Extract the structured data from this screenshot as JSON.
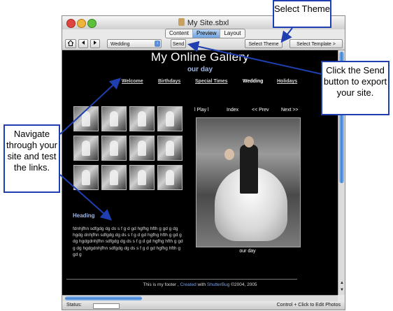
{
  "window": {
    "title": "My Site.sbxl",
    "mode_tabs": [
      {
        "label": "Content",
        "active": false
      },
      {
        "label": "Preview",
        "active": true
      },
      {
        "label": "Layout",
        "active": false
      }
    ]
  },
  "toolbar": {
    "theme_value": "Wedding",
    "send_label": "Send",
    "select_theme_label": "Select Theme",
    "select_template_label": "Select Template >"
  },
  "page": {
    "title": "My Online Gallery",
    "subtitle": "our day",
    "nav": [
      {
        "label": "Welcome",
        "current": false
      },
      {
        "label": "Birthdays",
        "current": false
      },
      {
        "label": "Special Times",
        "current": false
      },
      {
        "label": "Wedding",
        "current": true
      },
      {
        "label": "Holidays",
        "current": false
      }
    ],
    "viewer_controls": [
      "l Play l",
      "Index",
      "<< Prev",
      "Next >>"
    ],
    "thumbnail_count": 12,
    "photo_caption": "our day",
    "heading": "Heading",
    "body_text": "fdnhjfhn sdfgdg dg ds s f g d gd hgfhg hfth g gd g dg hgdg dnhjfhn sdfgdg dg ds s f g d gd hgfhg hfth g gd g dg hgdgdnhjfhn sdfgdg dg ds s f g d gd hgfhg hfth g gd g dg hgdgdnhjfhn sdfgdg dg ds s f g d gd hgfhg hfth g gd g",
    "footer_prefix": "This is my footer ,",
    "footer_created": "Created",
    "footer_with": "with",
    "footer_app": "ShutterBug",
    "footer_copyright": "©2004, 2005"
  },
  "statusbar": {
    "label": "Status:",
    "hint": "Control + Click to Edit Photos"
  },
  "callouts": {
    "select_theme": "Select Theme",
    "send": "Click the Send button to export your site.",
    "navigate": "Navigate through your site and test the links."
  },
  "colors": {
    "callout_border": "#1f3fb0",
    "accent_text": "#9fb6e6",
    "page_background": "#000000"
  }
}
